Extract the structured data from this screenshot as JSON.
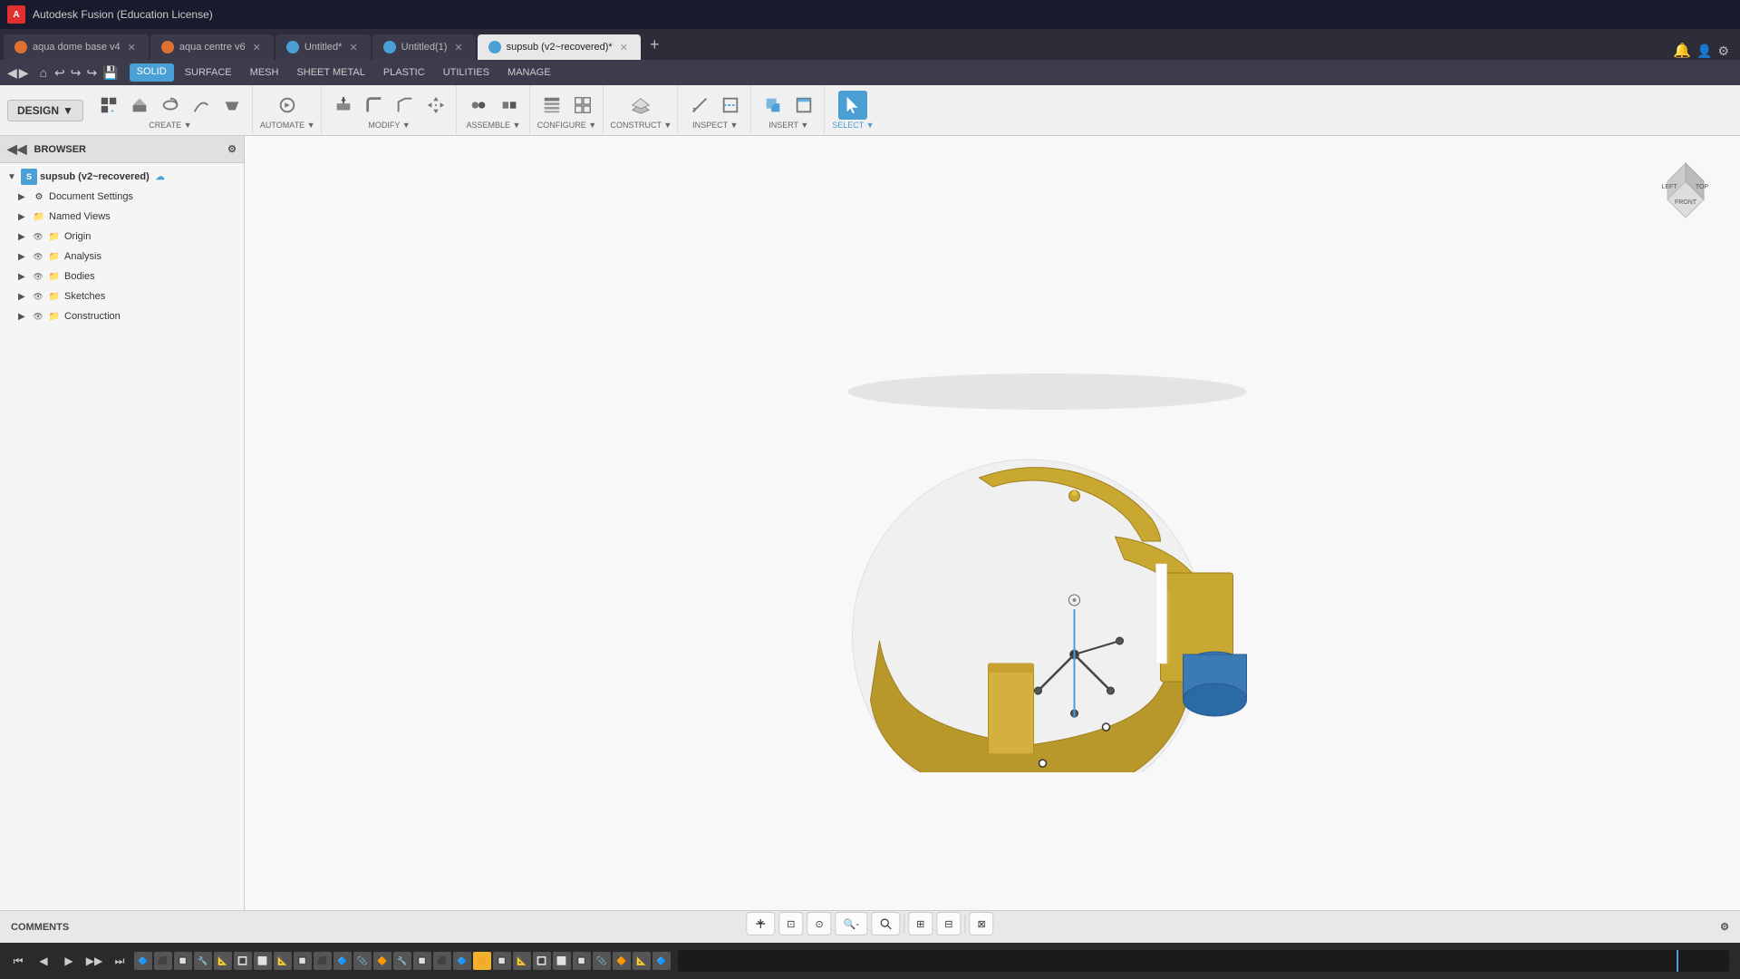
{
  "app": {
    "title": "Autodesk Fusion (Education License)",
    "icon": "A"
  },
  "tabs": [
    {
      "id": "tab1",
      "label": "aqua dome base v4",
      "icon_color": "#e07030",
      "active": false,
      "closable": true
    },
    {
      "id": "tab2",
      "label": "aqua centre v6",
      "icon_color": "#e07030",
      "active": false,
      "closable": true
    },
    {
      "id": "tab3",
      "label": "Untitled*",
      "icon_color": "#4a9fd4",
      "active": false,
      "closable": true
    },
    {
      "id": "tab4",
      "label": "Untitled(1)",
      "icon_color": "#4a9fd4",
      "active": false,
      "closable": true
    },
    {
      "id": "tab5",
      "label": "supsub (v2~recovered)*",
      "icon_color": "#4a9fd4",
      "active": true,
      "closable": true
    }
  ],
  "menu": {
    "items": [
      "SOLID",
      "SURFACE",
      "MESH",
      "SHEET METAL",
      "PLASTIC",
      "UTILITIES",
      "MANAGE"
    ],
    "active": "SOLID"
  },
  "toolbar": {
    "design_label": "DESIGN",
    "groups": [
      {
        "label": "CREATE",
        "has_dropdown": true
      },
      {
        "label": "AUTOMATE",
        "has_dropdown": true
      },
      {
        "label": "MODIFY",
        "has_dropdown": true
      },
      {
        "label": "ASSEMBLE",
        "has_dropdown": true
      },
      {
        "label": "CONFIGURE",
        "has_dropdown": true
      },
      {
        "label": "CONSTRUCT",
        "has_dropdown": true
      },
      {
        "label": "INSPECT",
        "has_dropdown": true
      },
      {
        "label": "INSERT",
        "has_dropdown": true
      },
      {
        "label": "SELECT",
        "has_dropdown": true
      }
    ]
  },
  "browser": {
    "title": "BROWSER",
    "root_label": "supsub (v2~recovered)",
    "items": [
      {
        "label": "Document Settings",
        "indent": 1,
        "arrow": "collapsed",
        "has_eye": false
      },
      {
        "label": "Named Views",
        "indent": 1,
        "arrow": "collapsed",
        "has_eye": false
      },
      {
        "label": "Origin",
        "indent": 1,
        "arrow": "collapsed",
        "has_eye": true
      },
      {
        "label": "Analysis",
        "indent": 1,
        "arrow": "collapsed",
        "has_eye": true
      },
      {
        "label": "Bodies",
        "indent": 1,
        "arrow": "collapsed",
        "has_eye": true
      },
      {
        "label": "Sketches",
        "indent": 1,
        "arrow": "collapsed",
        "has_eye": true
      },
      {
        "label": "Construction",
        "indent": 1,
        "arrow": "collapsed",
        "has_eye": true
      }
    ]
  },
  "comments": {
    "label": "COMMENTS"
  },
  "view_controls": {
    "buttons": [
      "⊕",
      "□",
      "⊙",
      "🔍-",
      "🔍",
      "⊞",
      "⊟",
      "⊠"
    ]
  },
  "timeline": {
    "play_first": "⏮",
    "play_prev": "◀",
    "play": "▶",
    "play_next": "▶▶",
    "play_last": "⏭"
  }
}
